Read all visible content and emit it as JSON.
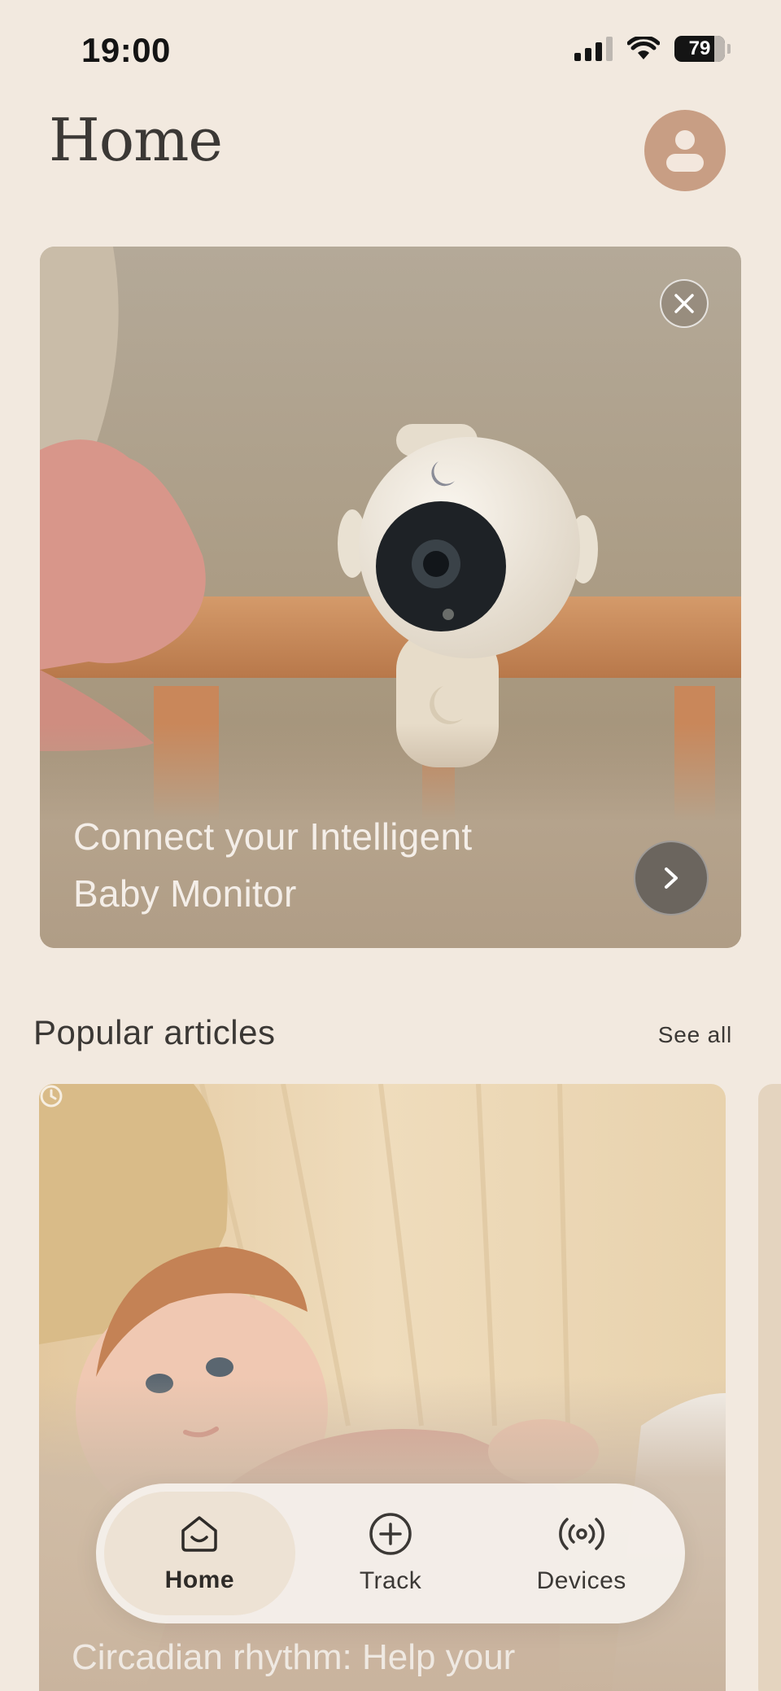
{
  "status_bar": {
    "time": "19:00",
    "battery": "79",
    "battery_level": 0.79,
    "icons": [
      "signal-icon",
      "wifi-icon",
      "battery-icon"
    ]
  },
  "header": {
    "title": "Home",
    "avatar_icon": "user-icon"
  },
  "promo": {
    "text_line1": "Connect your Intelligent",
    "text_line2": "Baby Monitor",
    "close_icon": "close-icon",
    "go_icon": "chevron-right-icon"
  },
  "articles": {
    "section_title": "Popular articles",
    "see_all": "See all",
    "items": [
      {
        "title": "Circadian rhythm: Help your",
        "icon": "clock-icon"
      }
    ]
  },
  "tab_bar": {
    "tabs": [
      {
        "label": "Home",
        "icon": "home-icon",
        "active": true
      },
      {
        "label": "Track",
        "icon": "plus-circle-icon",
        "active": false
      },
      {
        "label": "Devices",
        "icon": "broadcast-icon",
        "active": false
      }
    ]
  },
  "colors": {
    "background": "#f2e9df",
    "avatar": "#c89e84",
    "active_tab": "#ede2d4",
    "text": "#3b3835"
  }
}
